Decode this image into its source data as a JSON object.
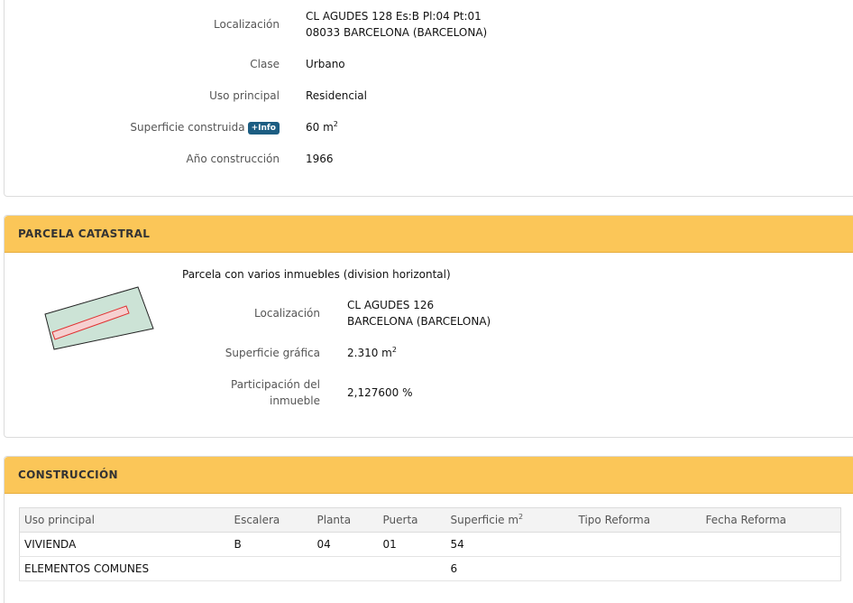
{
  "inmueble": {
    "localizacion_label": "Localización",
    "localizacion_line1": "CL AGUDES 128 Es:B Pl:04 Pt:01",
    "localizacion_line2": "08033 BARCELONA (BARCELONA)",
    "clase_label": "Clase",
    "clase_value": "Urbano",
    "uso_label": "Uso principal",
    "uso_value": "Residencial",
    "superficie_label": "Superficie construida",
    "info_badge": "+Info",
    "superficie_value": "60 m",
    "superficie_unit_sup": "2",
    "anio_label": "Año construcción",
    "anio_value": "1966"
  },
  "parcela": {
    "title": "PARCELA CATASTRAL",
    "description": "Parcela con varios inmuebles (division horizontal)",
    "localizacion_label": "Localización",
    "localizacion_line1": "CL AGUDES 126",
    "localizacion_line2": "BARCELONA (BARCELONA)",
    "superficie_label": "Superficie gráfica",
    "superficie_value": "2.310 m",
    "superficie_unit_sup": "2",
    "participacion_label_line1": "Participación del",
    "participacion_label_line2": "inmueble",
    "participacion_value": "2,127600 %",
    "map": {
      "parcel_fill": "#cce3d6",
      "unit_fill": "#f6d0d0",
      "unit_stroke": "#e03030"
    }
  },
  "construccion": {
    "title": "CONSTRUCCIÓN",
    "headers": [
      "Uso principal",
      "Escalera",
      "Planta",
      "Puerta",
      "Superficie m",
      "Tipo Reforma",
      "Fecha Reforma"
    ],
    "header_sup": "2",
    "rows": [
      [
        "VIVIENDA",
        "B",
        "04",
        "01",
        "54",
        "",
        ""
      ],
      [
        "ELEMENTOS COMUNES",
        "",
        "",
        "",
        "6",
        "",
        ""
      ]
    ]
  },
  "colors": {
    "header_bg": "#fbc658",
    "badge_bg": "#1c5d82"
  }
}
